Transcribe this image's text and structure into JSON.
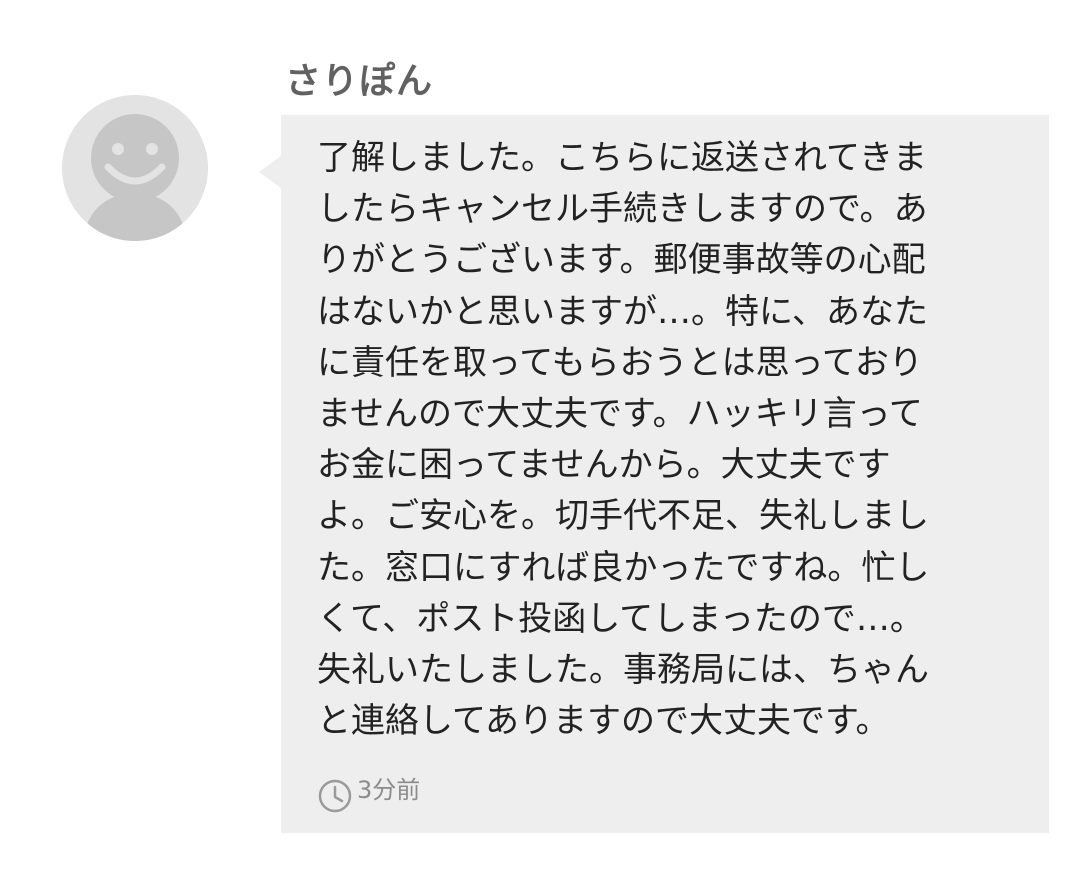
{
  "sender": {
    "name": "さりぽん",
    "avatar_icon": "default-user-face-icon"
  },
  "message": {
    "lines": [
      "了解しました。こちらに返送されてきま",
      "したらキャンセル手続きしますので。あ",
      "りがとうございます。郵便事故等の心配",
      "はないかと思いますが…。特に、あなた",
      "に責任を取ってもらおうとは思っており",
      "ませんので大丈夫です。ハッキリ言って",
      "お金に困ってませんから。大丈夫です",
      "よ。ご安心を。切手代不足、失礼しまし",
      "た。窓口にすれば良かったですね。忙し",
      "くて、ポスト投函してしまったので…。",
      "失礼いたしました。事務局には、ちゃん",
      "と連絡してありますので大丈夫です。"
    ],
    "timestamp": "3分前",
    "timestamp_icon": "clock-icon"
  },
  "colors": {
    "bubble_background": "#eeeeee",
    "avatar_background": "#e3e3e3",
    "avatar_face": "#c6c6c6",
    "sender_text": "#616161",
    "message_text": "#222222",
    "timestamp_text": "#8c8c8c"
  }
}
